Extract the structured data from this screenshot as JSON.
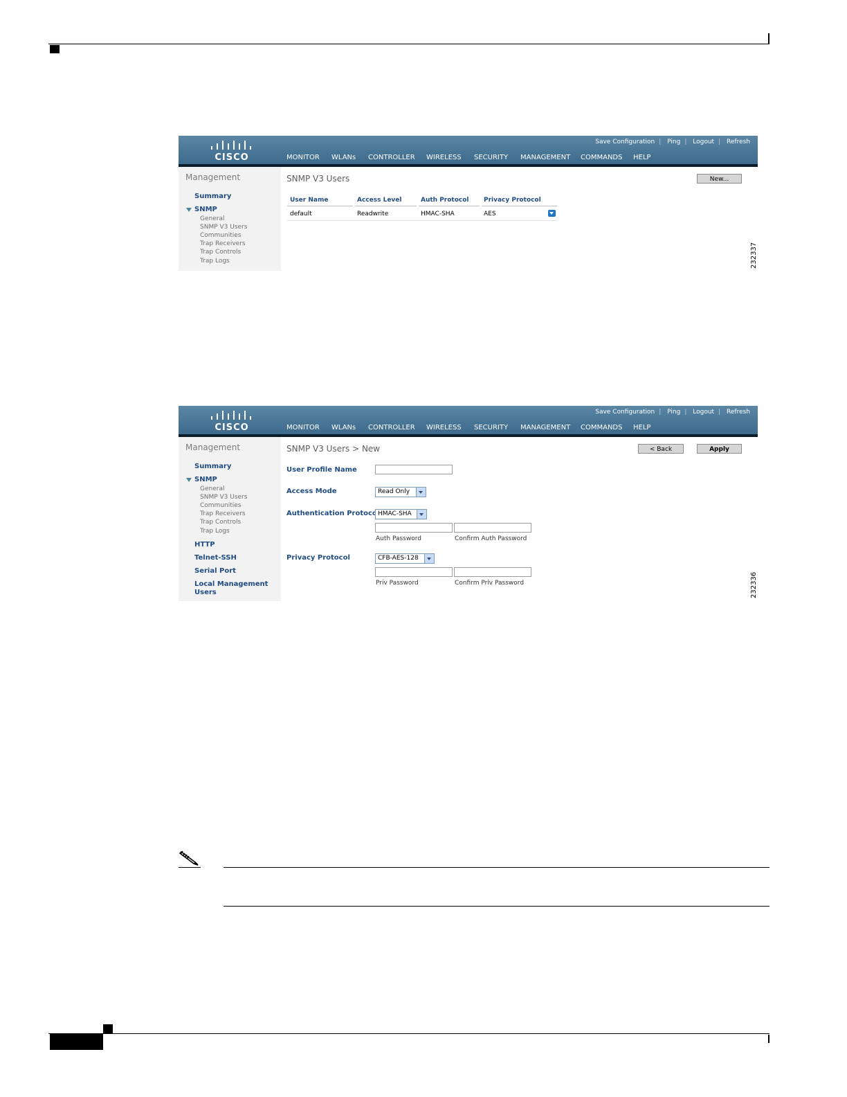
{
  "header": {
    "logo_text": "CISCO",
    "util_links": [
      "Save Configuration",
      "Ping",
      "Logout",
      "Refresh"
    ],
    "menu": [
      "MONITOR",
      "WLANs",
      "CONTROLLER",
      "WIRELESS",
      "SECURITY",
      "MANAGEMENT",
      "COMMANDS",
      "HELP"
    ],
    "active_menu": "MANAGEMENT",
    "accent_color": "#f0a33a"
  },
  "sidebar": {
    "title": "Management",
    "summary": "Summary",
    "snmp": "SNMP",
    "snmp_items": [
      "General",
      "SNMP V3 Users",
      "Communities",
      "Trap Receivers",
      "Trap Controls",
      "Trap Logs"
    ],
    "extra_items": [
      "HTTP",
      "Telnet-SSH",
      "Serial Port",
      "Local Management",
      "Users"
    ]
  },
  "screen1": {
    "title": "SNMP V3 Users",
    "new_button": "New...",
    "columns": [
      "User Name",
      "Access Level",
      "Auth Protocol",
      "Privacy Protocol"
    ],
    "row": [
      "default",
      "Readwrite",
      "HMAC-SHA",
      "AES"
    ],
    "figure_id": "232337"
  },
  "screen2": {
    "title": "SNMP V3 Users > New",
    "back_button": "< Back",
    "apply_button": "Apply",
    "user_profile_label": "User Profile Name",
    "user_profile_value": "",
    "access_mode_label": "Access Mode",
    "access_mode_value": "Read Only",
    "auth_protocol_label": "Authentication Protocol",
    "auth_protocol_value": "HMAC-SHA",
    "auth_password_label": "Auth Password",
    "confirm_auth_password_label": "Confirm Auth Password",
    "privacy_protocol_label": "Privacy Protocol",
    "privacy_protocol_value": "CFB-AES-128",
    "priv_password_label": "Priv Password",
    "confirm_priv_password_label": "Confirm Priv Password",
    "figure_id": "232336"
  },
  "note": {
    "icon": "pencil-note-icon"
  }
}
